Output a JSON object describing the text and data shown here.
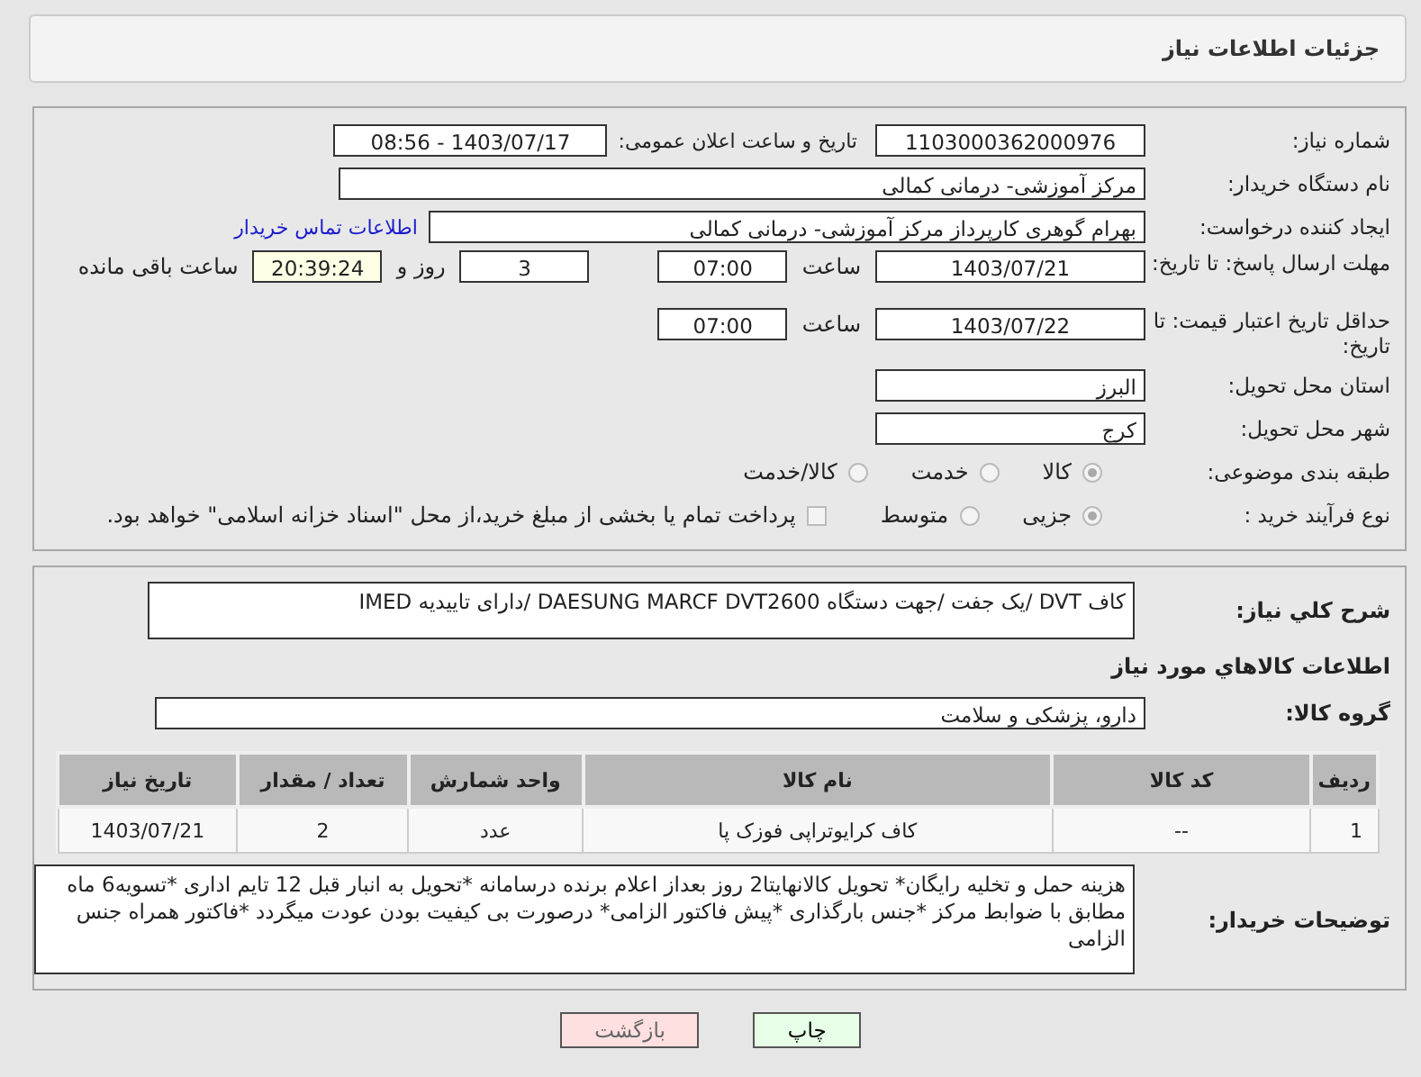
{
  "header": {
    "title": "جزئیات اطلاعات نیاز"
  },
  "need_number": {
    "label": "شماره نیاز:",
    "value": "1103000362000976"
  },
  "announce": {
    "label": "تاریخ و ساعت اعلان عمومی:",
    "value": "1403/07/17 - 08:56"
  },
  "buyer_org": {
    "label": "نام دستگاه خریدار:",
    "value": "مرکز آموزشی- درمانی کمالی"
  },
  "requester": {
    "label": "ایجاد کننده درخواست:",
    "value": "بهرام گوهری کارپرداز مرکز آموزشی- درمانی کمالی",
    "link": "اطلاعات تماس خریدار"
  },
  "reply_deadline": {
    "label": "مهلت ارسال پاسخ: تا تاریخ:",
    "date": "1403/07/21",
    "time_label": "ساعت",
    "time": "07:00",
    "days": "3",
    "days_label": "روز و",
    "remaining": "20:39:24",
    "remaining_label": "ساعت باقی مانده"
  },
  "price_validity": {
    "label": "حداقل تاریخ اعتبار قیمت: تا تاریخ:",
    "date": "1403/07/22",
    "time_label": "ساعت",
    "time": "07:00"
  },
  "province": {
    "label": "استان محل تحویل:",
    "value": "البرز"
  },
  "city": {
    "label": "شهر محل تحویل:",
    "value": "کرج"
  },
  "category": {
    "label": "طبقه بندی موضوعی:",
    "options": [
      {
        "label": "کالا",
        "selected": true
      },
      {
        "label": "خدمت",
        "selected": false
      },
      {
        "label": "کالا/خدمت",
        "selected": false
      }
    ]
  },
  "process": {
    "label": "نوع فرآیند خرید :",
    "options": [
      {
        "label": "جزیی",
        "selected": true
      },
      {
        "label": "متوسط",
        "selected": false
      }
    ],
    "payment": {
      "checked": false,
      "text": "پرداخت تمام یا بخشی از مبلغ خرید،از محل \"اسناد خزانه اسلامی\" خواهد بود."
    }
  },
  "summary": {
    "label": "شرح کلي نياز:",
    "value": "کاف DVT /یک جفت /جهت دستگاه DAESUNG MARCF DVT2600 /دارای تاییدیه IMED"
  },
  "goods": {
    "title": "اطلاعات کالاهاي مورد نياز",
    "group_label": "گروه کالا:",
    "group_value": "دارو، پزشکی و سلامت",
    "columns": [
      "ردیف",
      "کد کالا",
      "نام کالا",
      "واحد شمارش",
      "تعداد / مقدار",
      "تاریخ نیاز"
    ],
    "rows": [
      [
        "1",
        "--",
        "کاف کرایوتراپی فوزک پا",
        "عدد",
        "2",
        "1403/07/21"
      ]
    ]
  },
  "buyer_notes": {
    "label": "توضیحات خریدار:",
    "value": "هزینه حمل و تخلیه رایگان* تحویل کالانهایتا2 روز بعداز اعلام برنده درسامانه *تحویل به انبار قبل 12 تایم اداری *تسویه6 ماه مطابق با ضوابط مرکز *جنس بارگذاری *پیش فاکتور الزامی* درصورت بی کیفیت بودن عودت میگردد *فاکتور همراه جنس الزامی"
  },
  "buttons": [
    {
      "label": "چاپ",
      "kind": "print"
    },
    {
      "label": "بازگشت",
      "kind": "back"
    }
  ]
}
